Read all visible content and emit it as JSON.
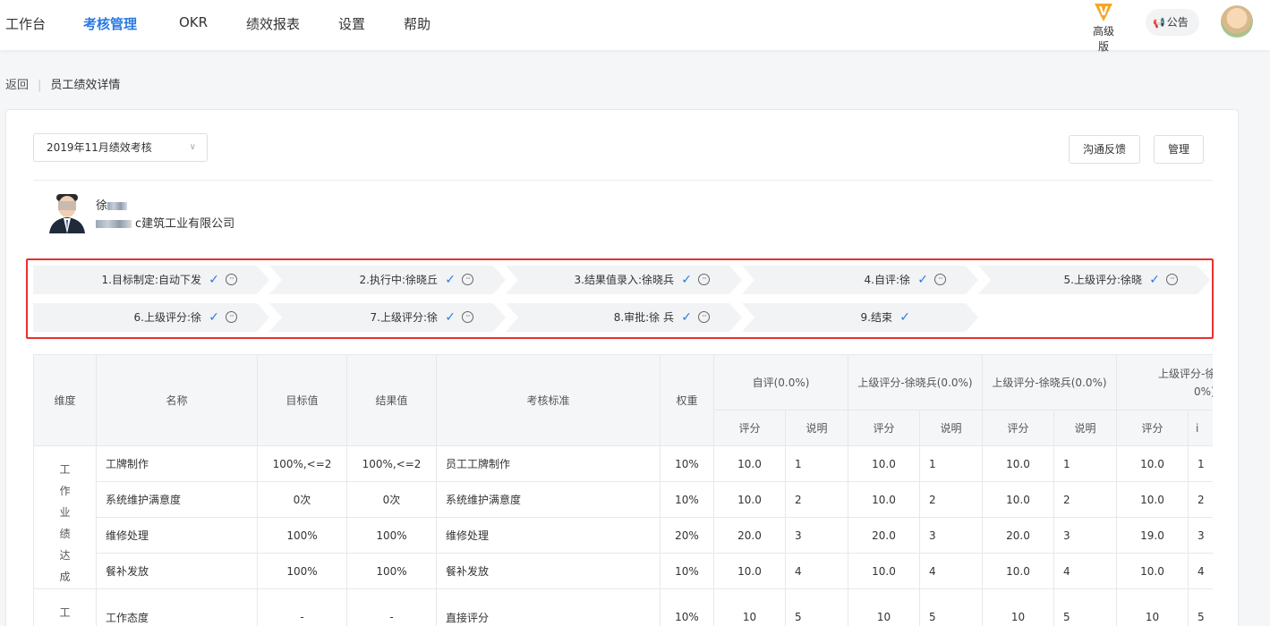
{
  "nav": {
    "items": [
      "工作台",
      "考核管理",
      "OKR",
      "绩效报表",
      "设置",
      "帮助"
    ],
    "active_index": 1,
    "vip_badge": "V",
    "vip_label": "高级版",
    "notice_label": "公告",
    "accent_color": "#2a7ae2"
  },
  "breadcrumb": {
    "back": "返回",
    "current": "员工绩效详情"
  },
  "period_select": {
    "value": "2019年11月绩效考核"
  },
  "actions": {
    "feedback": "沟通反馈",
    "manage": "管理"
  },
  "person": {
    "name": "徐",
    "company": "c建筑工业有限公司"
  },
  "flow_steps": [
    {
      "label": "1.目标制定:自动下发"
    },
    {
      "label": "2.执行中:徐晓丘"
    },
    {
      "label": "3.结果值录入:徐晓兵"
    },
    {
      "label": "4.自评:徐"
    },
    {
      "label": "5.上级评分:徐晓"
    },
    {
      "label": "6.上级评分:徐"
    },
    {
      "label": "7.上级评分:徐"
    },
    {
      "label": "8.审批:徐  兵"
    },
    {
      "label": "9.结束"
    }
  ],
  "table": {
    "headers": {
      "dimension": "维度",
      "name": "名称",
      "target": "目标值",
      "result": "结果值",
      "standard": "考核标准",
      "weight": "权重",
      "group1": "自评(0.0%)",
      "group2": "上级评分-徐晓兵(0.0%)",
      "group3": "上级评分-徐晓兵(0.0%)",
      "group4a": "上级评分-徐晓兵",
      "group4b": "0%)",
      "score": "评分",
      "note": "说明",
      "note_cut": "i"
    },
    "dimensions": [
      "工作业绩达成",
      "工作"
    ],
    "rows": [
      {
        "name": "工牌制作",
        "target": "100%,<=2",
        "result": "100%,<=2",
        "standard": "员工工牌制作",
        "weight": "10%",
        "s1": "10.0",
        "n1": "1",
        "s2": "10.0",
        "n2": "1",
        "s3": "10.0",
        "n3": "1",
        "s4": "10.0",
        "n4": "1"
      },
      {
        "name": "系统维护满意度",
        "target": "0次",
        "result": "0次",
        "standard": "系统维护满意度",
        "weight": "10%",
        "s1": "10.0",
        "n1": "2",
        "s2": "10.0",
        "n2": "2",
        "s3": "10.0",
        "n3": "2",
        "s4": "10.0",
        "n4": "2"
      },
      {
        "name": "维修处理",
        "target": "100%",
        "result": "100%",
        "standard": "维修处理",
        "weight": "20%",
        "s1": "20.0",
        "n1": "3",
        "s2": "20.0",
        "n2": "3",
        "s3": "20.0",
        "n3": "3",
        "s4": "19.0",
        "n4": "3"
      },
      {
        "name": "餐补发放",
        "target": "100%",
        "result": "100%",
        "standard": "餐补发放",
        "weight": "10%",
        "s1": "10.0",
        "n1": "4",
        "s2": "10.0",
        "n2": "4",
        "s3": "10.0",
        "n3": "4",
        "s4": "10.0",
        "n4": "4"
      },
      {
        "name": "工作态度",
        "target": "-",
        "result": "-",
        "standard": "直接评分",
        "weight": "10%",
        "s1": "10",
        "n1": "5",
        "s2": "10",
        "n2": "5",
        "s3": "10",
        "n3": "5",
        "s4": "10",
        "n4": "5"
      }
    ]
  }
}
